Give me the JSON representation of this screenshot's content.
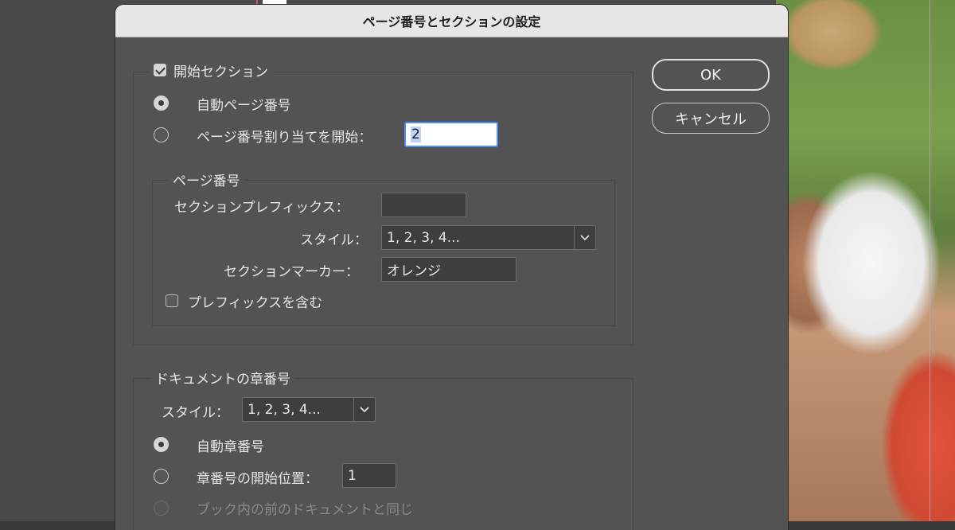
{
  "dialog": {
    "title": "ページ番号とセクションの設定",
    "ok_label": "OK",
    "cancel_label": "キャンセル"
  },
  "start_section": {
    "label": "開始セクション",
    "checked": true,
    "auto_page_label": "自動ページ番号",
    "start_page_label": "ページ番号割り当てを開始：",
    "start_page_value": "2"
  },
  "page_numbering": {
    "title": "ページ番号",
    "prefix_label": "セクションプレフィックス：",
    "prefix_value": "",
    "style_label": "スタイル：",
    "style_value": "1, 2, 3, 4...",
    "marker_label": "セクションマーカー：",
    "marker_value": "オレンジ",
    "include_prefix_label": "プレフィックスを含む",
    "include_prefix_checked": false
  },
  "chapter_numbering": {
    "title": "ドキュメントの章番号",
    "style_label": "スタイル：",
    "style_value": "1, 2, 3, 4...",
    "auto_label": "自動章番号",
    "start_at_label": "章番号の開始位置：",
    "start_at_value": "1",
    "same_as_prev_label": "ブック内の前のドキュメントと同じ"
  },
  "icons": {
    "dropdown": "chevron-down-icon",
    "check": "check-icon"
  }
}
